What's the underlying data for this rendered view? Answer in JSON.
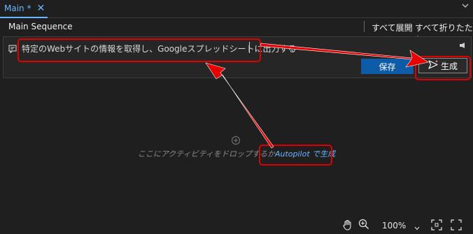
{
  "tab": {
    "label": "Main *",
    "close_glyph": "✕"
  },
  "header": {
    "title": "Main Sequence",
    "expand_all": "すべて展開",
    "collapse_all": "すべて折りたたむ"
  },
  "prompt": {
    "text": "特定のWebサイトの情報を取得し、Googleスプレッドシートに出力する",
    "save_label": "保存",
    "generate_label": "生成"
  },
  "canvas": {
    "drop_hint": "ここにアクティビティをドロップするか",
    "autopilot_link": "Autopilot で生成"
  },
  "zoom": {
    "level": "100%"
  },
  "icons": [
    "close-icon",
    "chevron-down-icon",
    "comment-icon",
    "speaker-icon",
    "send-icon",
    "add-icon",
    "hand-icon",
    "zoom-in-icon",
    "fit-icon",
    "fullscreen-icon"
  ],
  "colors": {
    "accent": "#6bb7ff",
    "save_button": "#0e5ba7",
    "annotation": "#e00000",
    "background": "#1f1f1f"
  }
}
